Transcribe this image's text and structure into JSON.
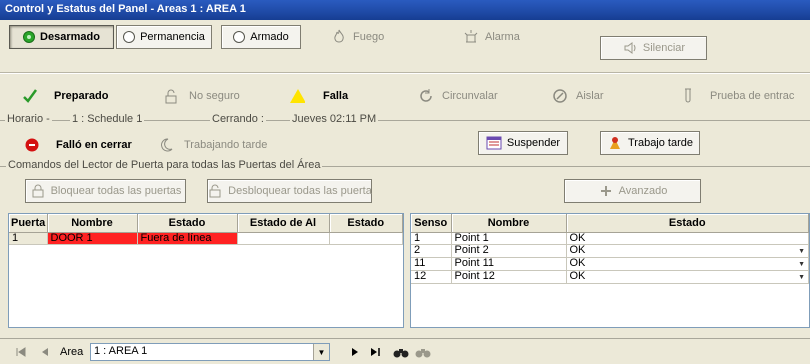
{
  "window": {
    "title": "Control y Estatus del Panel - Areas 1 : AREA 1"
  },
  "toolbar": {
    "desarmado": "Desarmado",
    "permanencia": "Permanencia",
    "armado": "Armado",
    "fuego": "Fuego",
    "alarma": "Alarma",
    "silenciar": "Silenciar"
  },
  "status": {
    "preparado": "Preparado",
    "no_seguro": "No seguro",
    "falla": "Falla",
    "circunvalar": "Circunvalar",
    "aislar": "Aislar",
    "prueba": "Prueba de entrac"
  },
  "schedule": {
    "horario_label": "Horario -",
    "horario_value": "1 : Schedule 1",
    "cerrando_label": "Cerrando :",
    "cerrando_value": "Jueves 02:11 PM"
  },
  "closing": {
    "fallo": "Falló en cerrar",
    "trabajando": "Trabajando tarde",
    "suspender": "Suspender",
    "trabajo_tarde": "Trabajo tarde"
  },
  "doors": {
    "group_label": "Comandos del Lector de Puerta para todas las Puertas del Área",
    "bloquear": "Bloquear todas las puertas",
    "desbloquear": "Desbloquear todas las puerta",
    "avanzado": "Avanzado"
  },
  "left_table": {
    "headers": [
      "Puerta",
      "Nombre",
      "Estado",
      "Estado de Al",
      "Estado"
    ],
    "rows": [
      {
        "puerta": "1",
        "nombre": "DOOR 1",
        "estado": "Fuera de línea",
        "estado_al": "",
        "estado2": ""
      }
    ]
  },
  "right_table": {
    "headers": [
      "Senso",
      "Nombre",
      "Estado"
    ],
    "rows": [
      {
        "sensor": "1",
        "nombre": "Point 1",
        "estado": "OK"
      },
      {
        "sensor": "2",
        "nombre": "Point 2",
        "estado": "OK"
      },
      {
        "sensor": "11",
        "nombre": "Point 11",
        "estado": "OK"
      },
      {
        "sensor": "12",
        "nombre": "Point 12",
        "estado": "OK"
      }
    ]
  },
  "statusbar": {
    "area_label": "Area",
    "area_value": "1 : AREA 1"
  },
  "colors": {
    "title_bg": "#1f4aa6",
    "offline_red": "#ff2222",
    "ready_green": "#2aa52a"
  }
}
